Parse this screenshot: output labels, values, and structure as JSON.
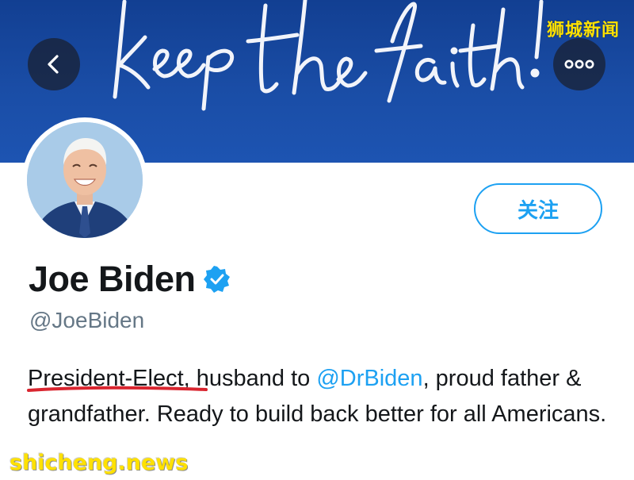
{
  "banner": {
    "script_text": "keep the faith!",
    "back_icon": "chevron-left-icon",
    "more_icon": "more-options-icon"
  },
  "watermarks": {
    "top_right": "狮城新闻",
    "bottom_left": "shicheng.news"
  },
  "profile": {
    "name": "Joe Biden",
    "verified_icon": "verified-badge-icon",
    "handle": "@JoeBiden",
    "follow_label": "关注",
    "bio": {
      "part1": "President-Elect",
      "part2": ", husband to ",
      "mention": "@DrBiden",
      "part3": ", proud father & grandfather. Ready to build back better for all Americans."
    }
  },
  "colors": {
    "banner_blue": "#1a4da6",
    "link_blue": "#1da1f2",
    "underline_red": "#d9252f",
    "watermark_yellow": "#ffe100"
  }
}
